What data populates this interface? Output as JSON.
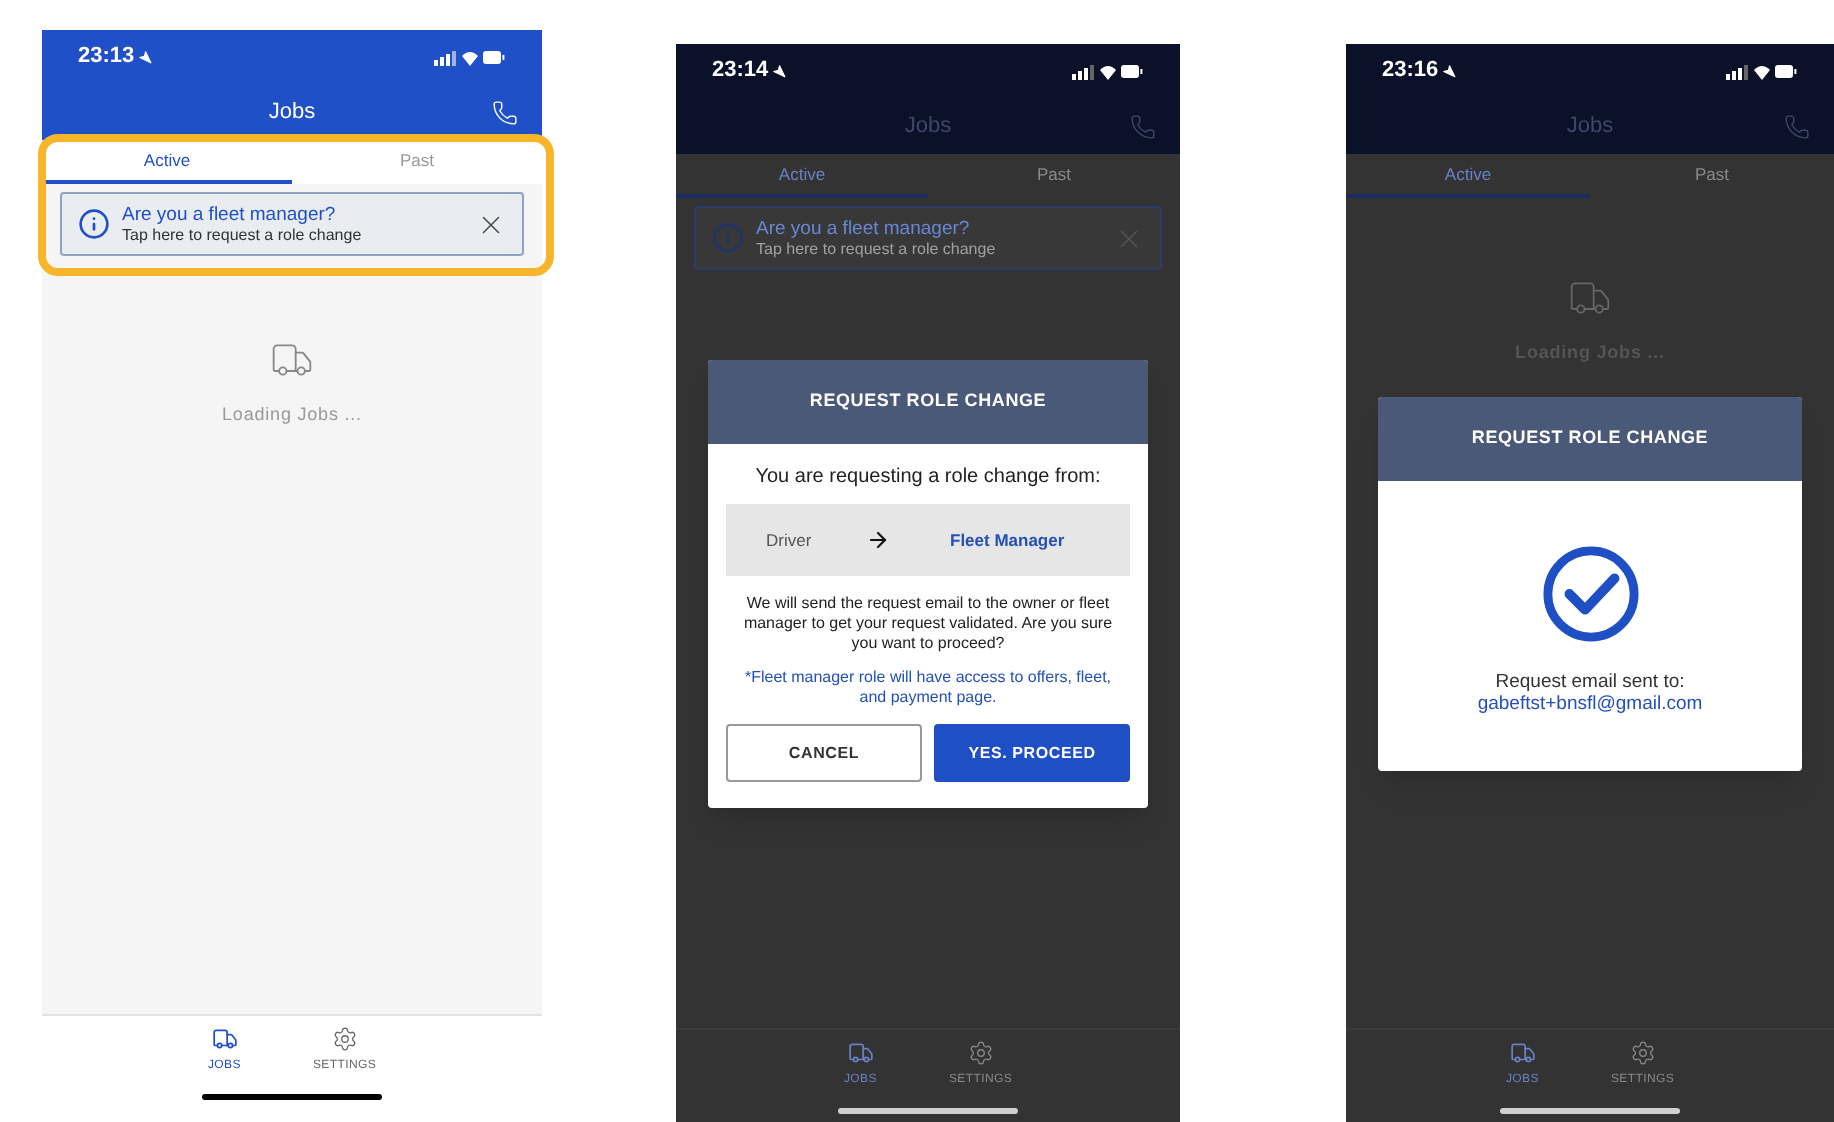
{
  "screens": [
    {
      "status_time": "23:13",
      "title": "Jobs",
      "dimmed": false,
      "tabs": [
        {
          "label": "Active",
          "selected": true
        },
        {
          "label": "Past",
          "selected": false
        }
      ],
      "banner": {
        "title": "Are you a fleet manager?",
        "subtitle": "Tap here to request a role change",
        "highlighted": true
      },
      "loading_text": "Loading Jobs ...",
      "nav": [
        {
          "label": "JOBS",
          "kind": "truck",
          "selected": true
        },
        {
          "label": "SETTINGS",
          "kind": "gear",
          "selected": false
        }
      ]
    },
    {
      "status_time": "23:14",
      "title": "Jobs",
      "dimmed": true,
      "tabs": [
        {
          "label": "Active",
          "selected": true
        },
        {
          "label": "Past",
          "selected": false
        }
      ],
      "banner": {
        "title": "Are you a fleet manager?",
        "subtitle": "Tap here to request a role change"
      },
      "dialog": {
        "kind": "confirm",
        "title": "REQUEST ROLE CHANGE",
        "intro": "You are requesting a role change from:",
        "from_role": "Driver",
        "to_role": "Fleet Manager",
        "message": "We will send the request email to the owner or fleet manager to get your request validated. Are you sure you want to proceed?",
        "note": "*Fleet manager role will have access to offers, fleet, and payment page.",
        "buttons": [
          {
            "label": "CANCEL",
            "kind": "secondary"
          },
          {
            "label": "YES. PROCEED",
            "kind": "primary"
          }
        ]
      },
      "nav": [
        {
          "label": "JOBS",
          "kind": "truck",
          "selected": true
        },
        {
          "label": "SETTINGS",
          "kind": "gear",
          "selected": false
        }
      ]
    },
    {
      "status_time": "23:16",
      "title": "Jobs",
      "dimmed": true,
      "tabs": [
        {
          "label": "Active",
          "selected": true
        },
        {
          "label": "Past",
          "selected": false
        }
      ],
      "loading_text": "Loading Jobs ...",
      "dialog": {
        "kind": "success",
        "title": "REQUEST ROLE CHANGE",
        "message": "Request email sent to:",
        "email": "gabeftst+bnsfl@gmail.com"
      },
      "nav": [
        {
          "label": "JOBS",
          "kind": "truck",
          "selected": true
        },
        {
          "label": "SETTINGS",
          "kind": "gear",
          "selected": false
        }
      ]
    }
  ]
}
